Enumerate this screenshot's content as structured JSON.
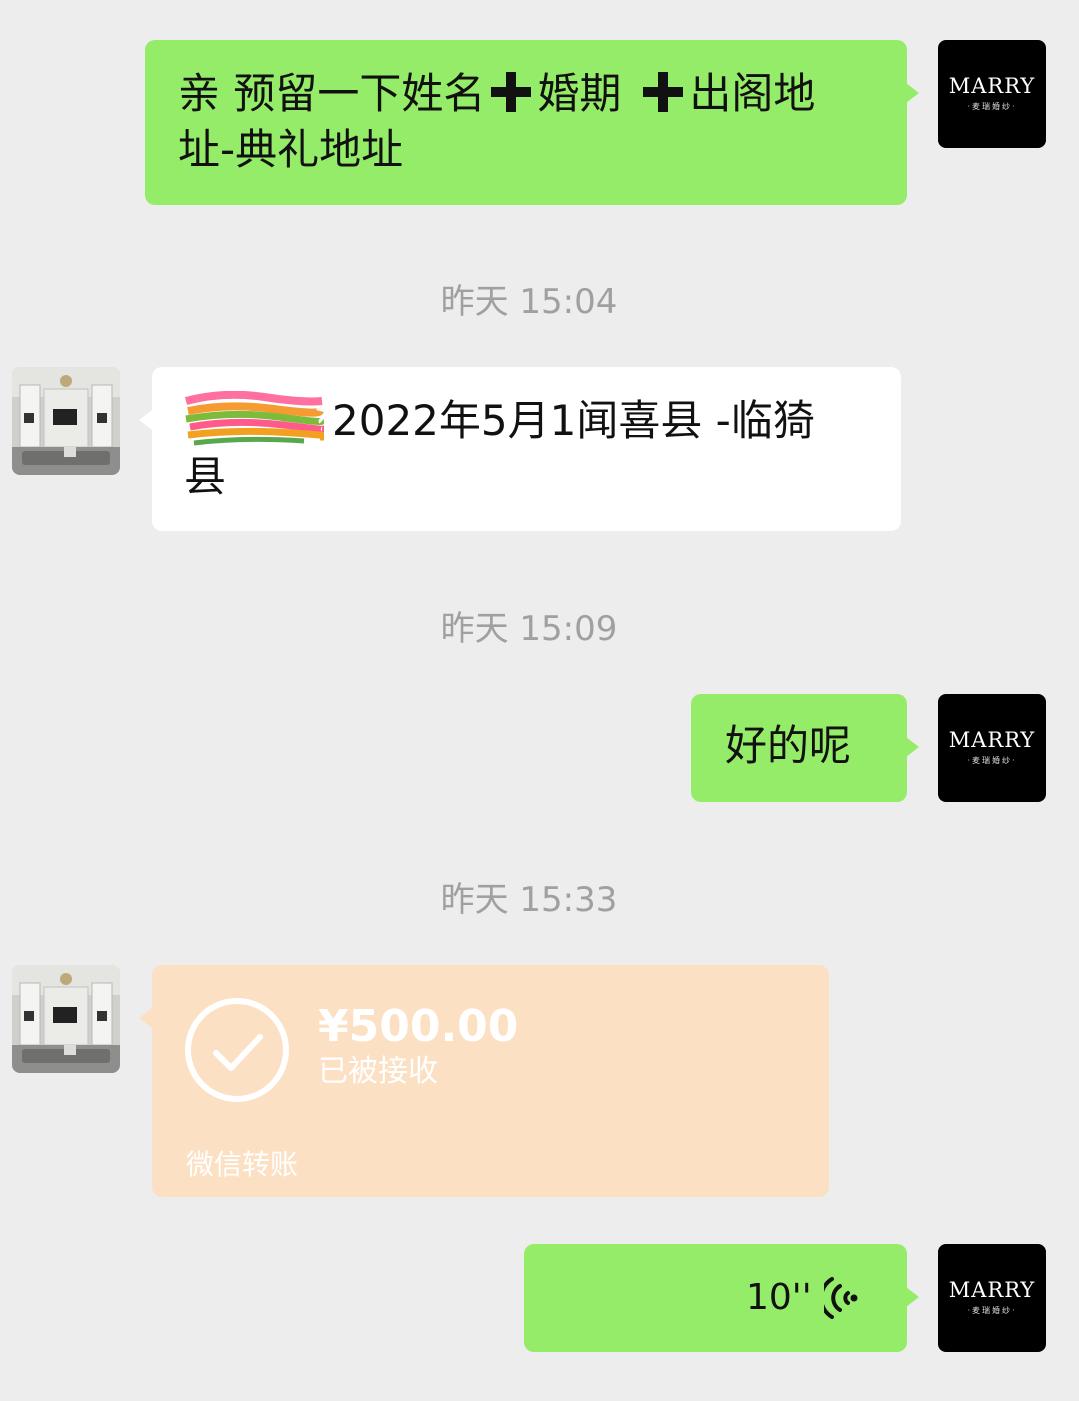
{
  "brand": {
    "name": "MARRY",
    "subtitle": "·麦瑞婚纱·"
  },
  "messages": [
    {
      "sender": "me",
      "type": "text",
      "parts": [
        "亲 预留一下姓名",
        "婚期",
        "出阁地",
        "址-典礼地址"
      ]
    },
    {
      "type": "timestamp",
      "text": "昨天 15:04"
    },
    {
      "sender": "them",
      "type": "text",
      "line1": "2022年5月1闻喜县 -临猗",
      "line2": "县"
    },
    {
      "type": "timestamp",
      "text": "昨天 15:09"
    },
    {
      "sender": "me",
      "type": "text",
      "text": "好的呢"
    },
    {
      "type": "timestamp",
      "text": "昨天 15:33"
    },
    {
      "sender": "them",
      "type": "transfer",
      "amount": "¥500.00",
      "status": "已被接收",
      "footer": "微信转账"
    },
    {
      "sender": "me",
      "type": "voice",
      "duration": "10''"
    }
  ],
  "colors": {
    "background": "#ededed",
    "my_bubble": "#95ec69",
    "their_bubble": "#ffffff",
    "transfer_bubble": "#fce0c4",
    "timestamp_text": "#a0a0a0"
  },
  "icons": {
    "check": "check-circle-icon",
    "voice": "voice-wave-icon"
  }
}
